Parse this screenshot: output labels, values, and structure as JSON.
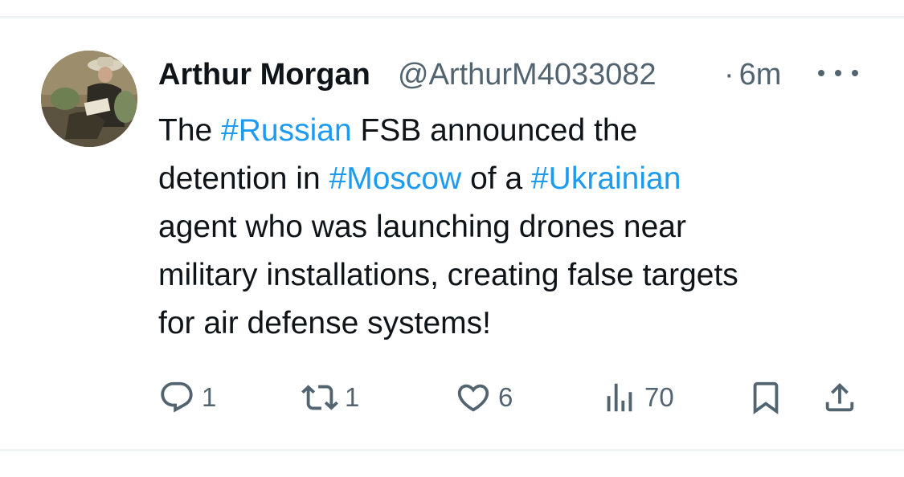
{
  "tweet": {
    "author_name": "Arthur Morgan",
    "handle": "@ArthurM4033082",
    "separator": "·",
    "time": "6m",
    "text_lines": [
      [
        {
          "t": "The ",
          "tag": false
        },
        {
          "t": "#Russian",
          "tag": true
        },
        {
          "t": " FSB announced the",
          "tag": false
        }
      ],
      [
        {
          "t": "detention in ",
          "tag": false
        },
        {
          "t": "#Moscow",
          "tag": true
        },
        {
          "t": " of a ",
          "tag": false
        },
        {
          "t": "#Ukrainian",
          "tag": true
        }
      ],
      [
        {
          "t": "agent who was launching drones near",
          "tag": false
        }
      ],
      [
        {
          "t": "military installations, creating false targets",
          "tag": false
        }
      ],
      [
        {
          "t": "for air defense systems!",
          "tag": false
        }
      ]
    ]
  },
  "actions": {
    "reply_count": "1",
    "retweet_count": "1",
    "like_count": "6",
    "views_count": "70"
  },
  "icons": {
    "avatar": "avatar-photo",
    "more": "more-icon",
    "reply": "reply-icon",
    "retweet": "retweet-icon",
    "like": "heart-icon",
    "views": "views-icon",
    "bookmark": "bookmark-icon",
    "share": "share-icon"
  },
  "colors": {
    "hashtag": "#1d9bf0",
    "secondary_text": "#536471",
    "primary_text": "#0f1419"
  }
}
